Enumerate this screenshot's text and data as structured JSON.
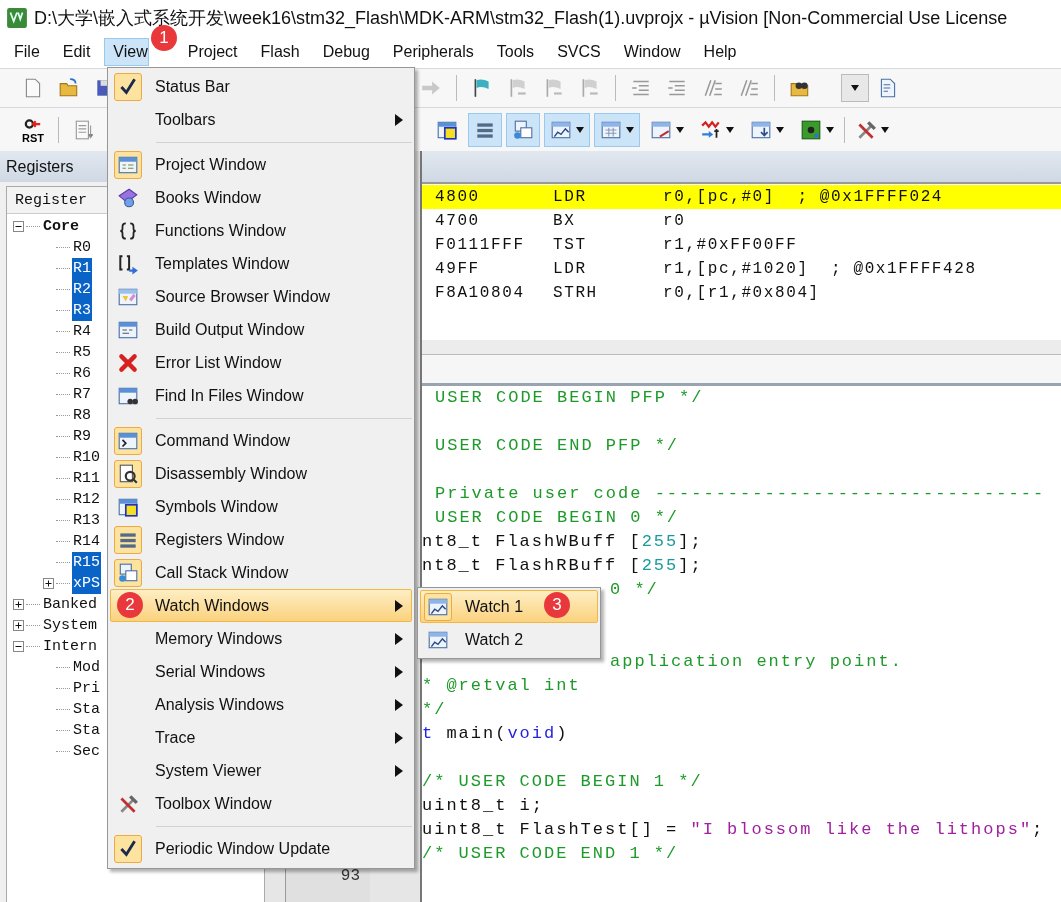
{
  "window": {
    "title": "D:\\大学\\嵌入式系统开发\\week16\\stm32_Flash\\MDK-ARM\\stm32_Flash(1).uvprojx - µVision  [Non-Commercial Use License"
  },
  "menubar": [
    {
      "label": "File",
      "selected": false
    },
    {
      "label": "Edit",
      "selected": false
    },
    {
      "label": "View",
      "selected": true
    },
    {
      "label": "Project",
      "selected": false
    },
    {
      "label": "Flash",
      "selected": false
    },
    {
      "label": "Debug",
      "selected": false
    },
    {
      "label": "Peripherals",
      "selected": false
    },
    {
      "label": "Tools",
      "selected": false
    },
    {
      "label": "SVCS",
      "selected": false
    },
    {
      "label": "Window",
      "selected": false
    },
    {
      "label": "Help",
      "selected": false
    }
  ],
  "debug_toolbar": {
    "rst_label": "RST",
    "buttons": [
      {
        "on": false
      },
      {
        "on": true
      },
      {
        "on": true
      },
      {
        "on": true
      },
      {
        "on": true
      },
      {
        "on": false
      },
      {
        "on": false
      },
      {
        "on": false
      },
      {
        "on": false
      },
      {
        "on": false
      }
    ]
  },
  "registers_panel": {
    "title": "Registers",
    "column": "Register",
    "tree": [
      {
        "label": "Core",
        "expanded": true,
        "selected": false,
        "children": [
          {
            "label": "R0",
            "selected": false
          },
          {
            "label": "R1",
            "selected": true
          },
          {
            "label": "R2",
            "selected": true
          },
          {
            "label": "R3",
            "selected": true
          },
          {
            "label": "R4",
            "selected": false
          },
          {
            "label": "R5",
            "selected": false
          },
          {
            "label": "R6",
            "selected": false
          },
          {
            "label": "R7",
            "selected": false
          },
          {
            "label": "R8",
            "selected": false
          },
          {
            "label": "R9",
            "selected": false
          },
          {
            "label": "R10",
            "selected": false
          },
          {
            "label": "R11",
            "selected": false
          },
          {
            "label": "R12",
            "selected": false
          },
          {
            "label": "R13",
            "selected": false
          },
          {
            "label": "R14",
            "selected": false
          },
          {
            "label": "R15",
            "selected": true
          },
          {
            "label": "xPS",
            "selected": true,
            "expanded": false
          }
        ]
      },
      {
        "label": "Banked",
        "expanded": false,
        "selected": false
      },
      {
        "label": "System",
        "expanded": false,
        "selected": false
      },
      {
        "label": "Intern",
        "expanded": true,
        "selected": false,
        "children": [
          {
            "label": "Mod",
            "selected": false
          },
          {
            "label": "Pri",
            "selected": false
          },
          {
            "label": "Sta",
            "selected": false
          },
          {
            "label": "Sta",
            "selected": false
          },
          {
            "label": "Sec",
            "selected": false
          }
        ]
      }
    ]
  },
  "line_numbers": [
    "93"
  ],
  "disassembly": [
    {
      "address": "4800",
      "mnemonic": "LDR",
      "operands": "r0,[pc,#0]  ; @0x1FFFF024",
      "current": true
    },
    {
      "address": "4700",
      "mnemonic": "BX",
      "operands": "r0",
      "current": false
    },
    {
      "address": "F0111FFF",
      "mnemonic": "TST",
      "operands": "r1,#0xFF00FF",
      "current": false
    },
    {
      "address": "49FF",
      "mnemonic": "LDR",
      "operands": "r1,[pc,#1020]  ; @0x1FFFF428",
      "current": false
    },
    {
      "address": "F8A10804",
      "mnemonic": "STRH",
      "operands": "r0,[r1,#0x804]",
      "current": false
    }
  ],
  "code_lines": [
    {
      "kind": "full",
      "parts": [
        {
          "kind": "comment",
          "text": "USER CODE BEGIN PFP */"
        }
      ]
    },
    {
      "kind": "full"
    },
    {
      "kind": "full",
      "parts": [
        {
          "kind": "comment",
          "text": "USER CODE END PFP */"
        }
      ]
    },
    {
      "kind": "full"
    },
    {
      "kind": "full",
      "parts": [
        {
          "kind": "comment",
          "text": "Private user code --------------------------------"
        }
      ]
    },
    {
      "kind": "full",
      "parts": [
        {
          "kind": "comment",
          "text": "USER CODE BEGIN 0 */"
        }
      ]
    },
    {
      "kind": "full",
      "parts": [
        {
          "kind": "plain",
          "text": "nt8_t FlashWBuff ["
        },
        {
          "kind": "number",
          "text": "255"
        },
        {
          "kind": "plain",
          "text": "];"
        }
      ]
    },
    {
      "kind": "full",
      "parts": [
        {
          "kind": "plain",
          "text": "nt8_t FlashRBuff ["
        },
        {
          "kind": "number",
          "text": "255"
        },
        {
          "kind": "plain",
          "text": "];"
        }
      ]
    },
    {
      "kind": "partial",
      "parts": [
        {
          "kind": "comment",
          "text": "0 */"
        }
      ]
    },
    {
      "kind": "full"
    },
    {
      "kind": "full"
    },
    {
      "kind": "partial",
      "parts": [
        {
          "kind": "comment",
          "text": "application entry point."
        }
      ]
    },
    {
      "kind": "full",
      "parts": [
        {
          "kind": "comment",
          "text": "* @retval int"
        }
      ]
    },
    {
      "kind": "full",
      "parts": [
        {
          "kind": "comment",
          "text": "*/"
        }
      ]
    },
    {
      "kind": "full",
      "parts": [
        {
          "kind": "keyword",
          "text": "t"
        },
        {
          "kind": "plain",
          "text": " main("
        },
        {
          "kind": "keyword",
          "text": "void"
        },
        {
          "kind": "plain",
          "text": ")"
        }
      ]
    },
    {
      "kind": "full"
    },
    {
      "kind": "full",
      "parts": [
        {
          "kind": "comment",
          "text": "/* USER CODE BEGIN 1 */"
        }
      ]
    },
    {
      "kind": "full",
      "parts": [
        {
          "kind": "plain",
          "text": "uint8_t i;"
        }
      ]
    },
    {
      "kind": "full",
      "parts": [
        {
          "kind": "plain",
          "text": "uint8_t FlashTest[] = "
        },
        {
          "kind": "string",
          "text": "\"I blossom like the lithops\""
        },
        {
          "kind": "plain",
          "text": ";"
        }
      ]
    },
    {
      "kind": "full",
      "parts": [
        {
          "kind": "comment",
          "text": "/* USER CODE END 1 */"
        }
      ]
    }
  ],
  "view_menu": {
    "items": [
      {
        "label": "Status Bar",
        "kind": "command",
        "checked": true,
        "selected": false
      },
      {
        "label": "Toolbars",
        "kind": "submenu",
        "checked": false,
        "selected": false
      },
      {
        "kind": "separator"
      },
      {
        "label": "Project Window",
        "kind": "command",
        "checked": true,
        "selected": false
      },
      {
        "label": "Books Window",
        "kind": "command",
        "checked": false,
        "selected": false
      },
      {
        "label": "Functions Window",
        "kind": "command",
        "checked": false,
        "selected": false
      },
      {
        "label": "Templates Window",
        "kind": "command",
        "checked": false,
        "selected": false
      },
      {
        "label": "Source Browser Window",
        "kind": "command",
        "checked": false,
        "selected": false
      },
      {
        "label": "Build Output Window",
        "kind": "command",
        "checked": false,
        "selected": false
      },
      {
        "label": "Error List Window",
        "kind": "command",
        "checked": false,
        "selected": false
      },
      {
        "label": "Find In Files Window",
        "kind": "command",
        "checked": false,
        "selected": false
      },
      {
        "kind": "separator"
      },
      {
        "label": "Command Window",
        "kind": "command",
        "checked": true,
        "selected": false
      },
      {
        "label": "Disassembly Window",
        "kind": "command",
        "checked": true,
        "selected": false
      },
      {
        "label": "Symbols Window",
        "kind": "command",
        "checked": false,
        "selected": false
      },
      {
        "label": "Registers Window",
        "kind": "command",
        "checked": true,
        "selected": false
      },
      {
        "label": "Call Stack Window",
        "kind": "command",
        "checked": true,
        "selected": false
      },
      {
        "label": "Watch Windows",
        "kind": "submenu",
        "checked": false,
        "selected": true
      },
      {
        "label": "Memory Windows",
        "kind": "submenu",
        "checked": false,
        "selected": false
      },
      {
        "label": "Serial Windows",
        "kind": "submenu",
        "checked": false,
        "selected": false
      },
      {
        "label": "Analysis Windows",
        "kind": "submenu",
        "checked": false,
        "selected": false
      },
      {
        "label": "Trace",
        "kind": "submenu",
        "checked": false,
        "selected": false
      },
      {
        "label": "System Viewer",
        "kind": "submenu",
        "checked": false,
        "selected": false
      },
      {
        "label": "Toolbox Window",
        "kind": "command",
        "checked": false,
        "selected": false
      },
      {
        "kind": "separator"
      },
      {
        "label": "Periodic Window Update",
        "kind": "command",
        "checked": true,
        "selected": false
      }
    ]
  },
  "watch_submenu": [
    {
      "label": "Watch 1",
      "selected": true
    },
    {
      "label": "Watch 2",
      "selected": false
    }
  ],
  "annotations": [
    {
      "label": "1"
    },
    {
      "label": "2"
    },
    {
      "label": "3"
    }
  ]
}
